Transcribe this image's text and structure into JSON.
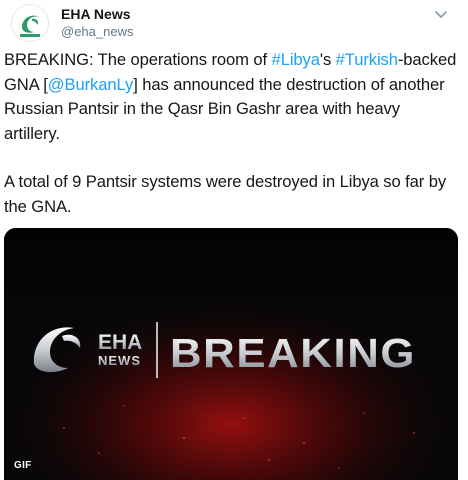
{
  "author": {
    "display_name": "EHA News",
    "handle": "@eha_news",
    "avatar_icon": "eha-news-logo-icon"
  },
  "tweet": {
    "p1": {
      "t1": "BREAKING: The operations room of ",
      "l1": "#Libya",
      "t2": "'s ",
      "l2": "#Turkish",
      "t3": "-backed GNA [",
      "l3": "@BurkanLy",
      "t4": "] has announced the destruction of another Russian Pantsir in the Qasr Bin Gashr area with heavy artillery."
    },
    "p2": "A total of 9 Pantsir systems were destroyed in Libya so far by the GNA."
  },
  "media": {
    "logo_line1": "EHA",
    "logo_line2": "NEWS",
    "headline": "BREAKING",
    "badge": "GIF"
  },
  "colors": {
    "link": "#1da1f2",
    "text": "#14171a",
    "secondary": "#657786",
    "media_glow": "#9e1010"
  }
}
